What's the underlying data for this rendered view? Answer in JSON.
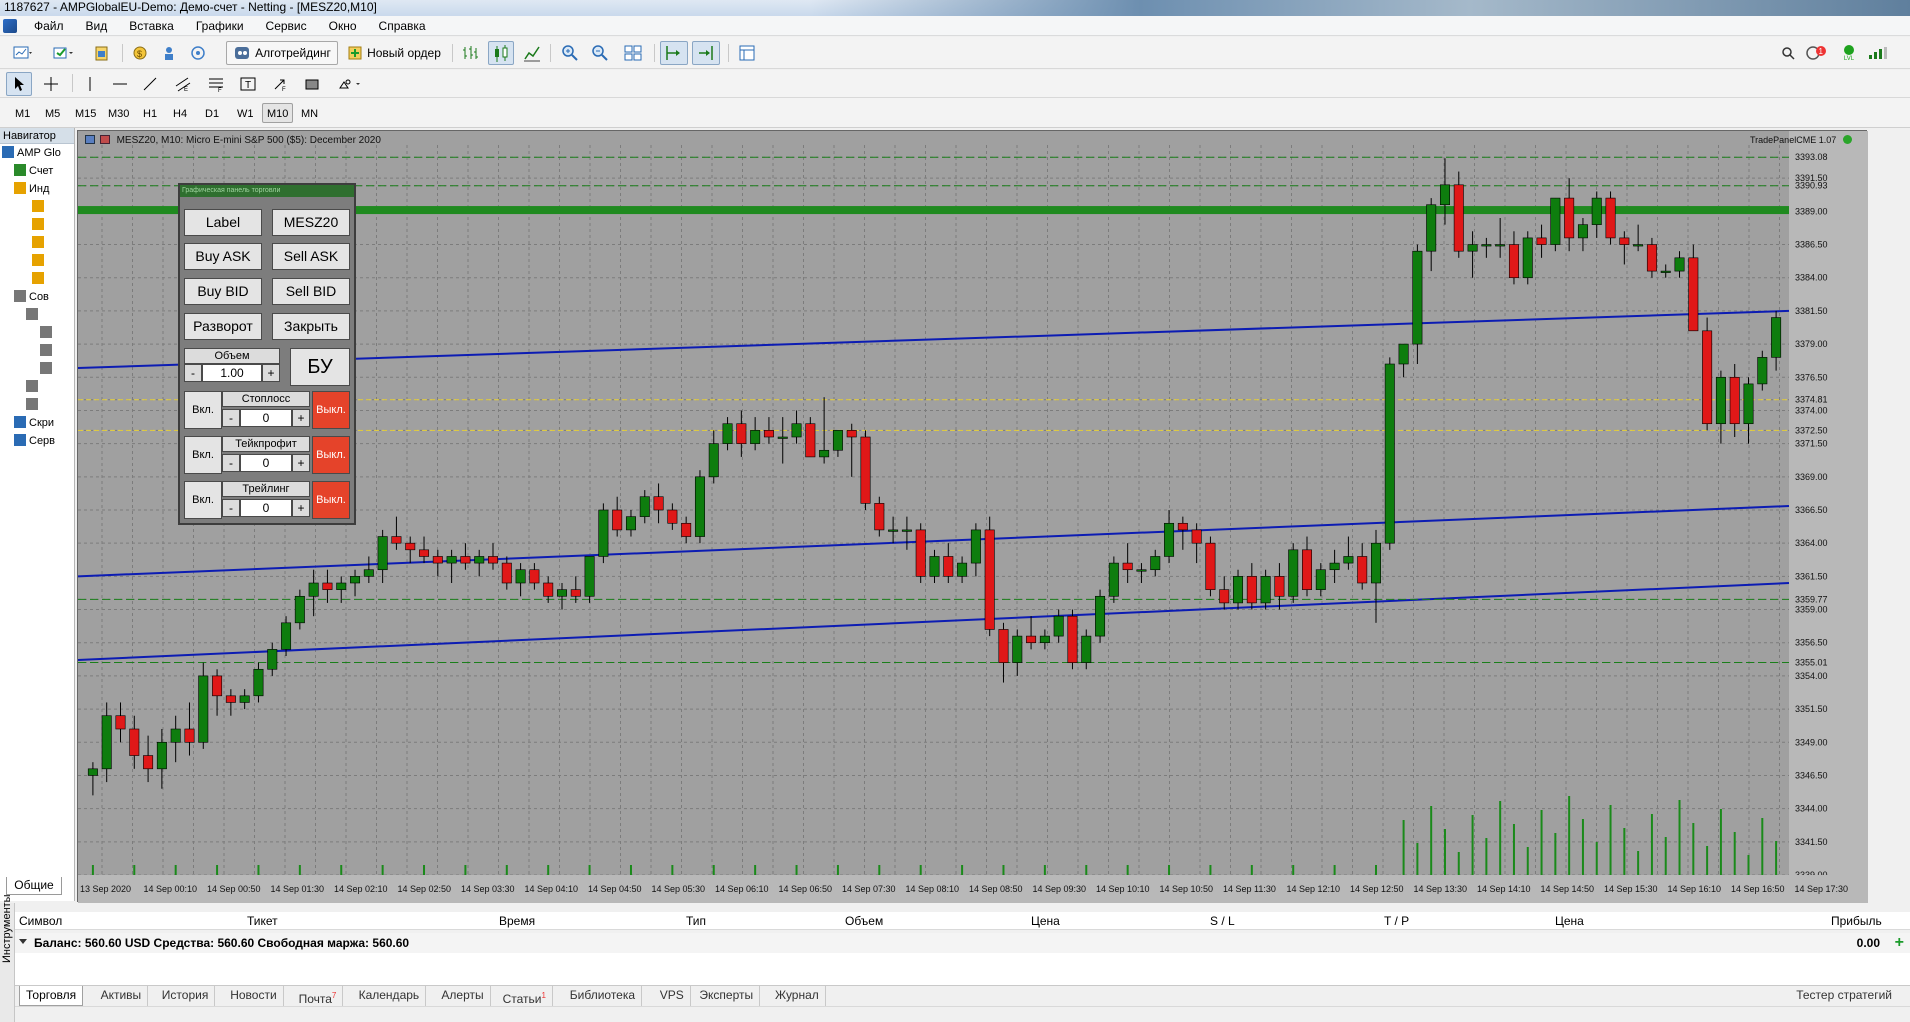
{
  "window": {
    "title": "1187627 - AMPGlobalEU-Demo: Демо-счет - Netting - [MESZ20,M10]"
  },
  "menu": [
    "Файл",
    "Вид",
    "Вставка",
    "Графики",
    "Сервис",
    "Окно",
    "Справка"
  ],
  "toolbar": {
    "algo_label": "Алготрейдинг",
    "new_order_label": "Новый ордер",
    "alert_badge": "1",
    "lvl_label": "LVL"
  },
  "timeframes": [
    "M1",
    "M5",
    "M15",
    "M30",
    "H1",
    "H4",
    "D1",
    "W1",
    "M10",
    "MN"
  ],
  "active_timeframe": "M10",
  "navigator": {
    "header": "Навигатор",
    "tab": "Общие",
    "rows": [
      "AMP Glo",
      "Счет",
      "Инд",
      "",
      "",
      "",
      "",
      "",
      "Сов",
      "",
      "",
      "",
      "",
      "",
      "",
      "Скри",
      "Серв"
    ]
  },
  "chart": {
    "title": "MESZ20, M10:  Micro E-mini S&P 500 ($5): December 2020",
    "ea_label": "TradePanelCME 1.07",
    "price_labels": [
      "3393.08",
      "3391.50",
      "3390.93",
      "3389.00",
      "3386.50",
      "3384.00",
      "3381.50",
      "3379.00",
      "3376.50",
      "3374.81",
      "3374.00",
      "3372.50",
      "3371.50",
      "3369.00",
      "3366.50",
      "3364.00",
      "3361.50",
      "3359.77",
      "3359.00",
      "3356.50",
      "3355.01",
      "3354.00",
      "3351.50",
      "3349.00",
      "3346.50",
      "3344.00",
      "3341.50",
      "3339.00"
    ],
    "time_labels": [
      "13 Sep 2020",
      "14 Sep 00:10",
      "14 Sep 00:50",
      "14 Sep 01:30",
      "14 Sep 02:10",
      "14 Sep 02:50",
      "14 Sep 03:30",
      "14 Sep 04:10",
      "14 Sep 04:50",
      "14 Sep 05:30",
      "14 Sep 06:10",
      "14 Sep 06:50",
      "14 Sep 07:30",
      "14 Sep 08:10",
      "14 Sep 08:50",
      "14 Sep 09:30",
      "14 Sep 10:10",
      "14 Sep 10:50",
      "14 Sep 11:30",
      "14 Sep 12:10",
      "14 Sep 12:50",
      "14 Sep 13:30",
      "14 Sep 14:10",
      "14 Sep 14:50",
      "14 Sep 15:30",
      "14 Sep 16:10",
      "14 Sep 16:50",
      "14 Sep 17:30"
    ],
    "colors": {
      "bull": "#0e7d0e",
      "bear": "#e01818",
      "channel": "#0c1cb3",
      "bg": "#a0a0a0",
      "grid": "#7c7c7c",
      "green_level": "#1f8a1f"
    }
  },
  "chart_data": {
    "type": "candlestick",
    "ylim": [
      3339,
      3394
    ],
    "candles": [
      [
        3346.5,
        3347.5,
        3345.0,
        3347.0
      ],
      [
        3347.0,
        3352.0,
        3346.0,
        3351.0
      ],
      [
        3351.0,
        3352.0,
        3349.0,
        3350.0
      ],
      [
        3350.0,
        3351.0,
        3347.0,
        3348.0
      ],
      [
        3348.0,
        3349.5,
        3346.0,
        3347.0
      ],
      [
        3347.0,
        3350.0,
        3345.5,
        3349.0
      ],
      [
        3349.0,
        3351.0,
        3347.5,
        3350.0
      ],
      [
        3350.0,
        3352.0,
        3348.0,
        3349.0
      ],
      [
        3349.0,
        3355.0,
        3348.5,
        3354.0
      ],
      [
        3354.0,
        3354.5,
        3351.0,
        3352.5
      ],
      [
        3352.5,
        3353.0,
        3351.0,
        3352.0
      ],
      [
        3352.0,
        3353.0,
        3351.5,
        3352.5
      ],
      [
        3352.5,
        3355.0,
        3352.0,
        3354.5
      ],
      [
        3354.5,
        3356.5,
        3354.0,
        3356.0
      ],
      [
        3356.0,
        3358.5,
        3355.5,
        3358.0
      ],
      [
        3358.0,
        3360.5,
        3357.5,
        3360.0
      ],
      [
        3360.0,
        3362.0,
        3358.5,
        3361.0
      ],
      [
        3361.0,
        3362.0,
        3359.5,
        3360.5
      ],
      [
        3360.5,
        3361.5,
        3359.5,
        3361.0
      ],
      [
        3361.0,
        3362.0,
        3360.0,
        3361.5
      ],
      [
        3361.5,
        3363.0,
        3361.0,
        3362.0
      ],
      [
        3362.0,
        3365.0,
        3361.0,
        3364.5
      ],
      [
        3364.5,
        3366.0,
        3363.5,
        3364.0
      ],
      [
        3364.0,
        3364.5,
        3362.5,
        3363.5
      ],
      [
        3363.5,
        3364.5,
        3362.5,
        3363.0
      ],
      [
        3363.0,
        3363.5,
        3361.5,
        3362.5
      ],
      [
        3362.5,
        3363.5,
        3361.0,
        3363.0
      ],
      [
        3363.0,
        3364.0,
        3362.0,
        3362.5
      ],
      [
        3362.5,
        3363.5,
        3361.5,
        3363.0
      ],
      [
        3363.0,
        3364.0,
        3362.0,
        3362.5
      ],
      [
        3362.5,
        3363.0,
        3360.5,
        3361.0
      ],
      [
        3361.0,
        3362.5,
        3360.0,
        3362.0
      ],
      [
        3362.0,
        3362.5,
        3360.5,
        3361.0
      ],
      [
        3361.0,
        3361.5,
        3359.5,
        3360.0
      ],
      [
        3360.0,
        3361.0,
        3359.0,
        3360.5
      ],
      [
        3360.5,
        3361.5,
        3359.5,
        3360.0
      ],
      [
        3360.0,
        3363.0,
        3359.5,
        3363.0
      ],
      [
        3363.0,
        3367.0,
        3362.5,
        3366.5
      ],
      [
        3366.5,
        3367.5,
        3364.5,
        3365.0
      ],
      [
        3365.0,
        3366.5,
        3364.5,
        3366.0
      ],
      [
        3366.0,
        3368.0,
        3365.5,
        3367.5
      ],
      [
        3367.5,
        3368.5,
        3365.5,
        3366.5
      ],
      [
        3366.5,
        3367.0,
        3365.0,
        3365.5
      ],
      [
        3365.5,
        3366.0,
        3364.0,
        3364.5
      ],
      [
        3364.5,
        3369.5,
        3364.0,
        3369.0
      ],
      [
        3369.0,
        3372.5,
        3368.5,
        3371.5
      ],
      [
        3371.5,
        3373.5,
        3371.0,
        3373.0
      ],
      [
        3373.0,
        3374.0,
        3370.5,
        3371.5
      ],
      [
        3371.5,
        3373.5,
        3371.0,
        3372.5
      ],
      [
        3372.5,
        3373.5,
        3371.5,
        3372.0
      ],
      [
        3372.0,
        3373.5,
        3370.0,
        3372.0
      ],
      [
        3372.0,
        3374.0,
        3371.5,
        3373.0
      ],
      [
        3373.0,
        3373.5,
        3370.5,
        3370.5
      ],
      [
        3370.5,
        3375.0,
        3370.0,
        3371.0
      ],
      [
        3371.0,
        3372.5,
        3370.5,
        3372.5
      ],
      [
        3372.5,
        3373.0,
        3369.0,
        3372.0
      ],
      [
        3372.0,
        3372.5,
        3366.5,
        3367.0
      ],
      [
        3367.0,
        3367.5,
        3364.5,
        3365.0
      ],
      [
        3365.0,
        3366.0,
        3364.0,
        3365.0
      ],
      [
        3365.0,
        3366.0,
        3363.5,
        3365.0
      ],
      [
        3365.0,
        3365.5,
        3361.0,
        3361.5
      ],
      [
        3361.5,
        3363.5,
        3361.0,
        3363.0
      ],
      [
        3363.0,
        3364.0,
        3361.0,
        3361.5
      ],
      [
        3361.5,
        3363.0,
        3361.0,
        3362.5
      ],
      [
        3362.5,
        3365.5,
        3361.5,
        3365.0
      ],
      [
        3365.0,
        3366.0,
        3357.0,
        3357.5
      ],
      [
        3357.5,
        3358.0,
        3353.5,
        3355.0
      ],
      [
        3355.0,
        3357.5,
        3354.0,
        3357.0
      ],
      [
        3357.0,
        3358.5,
        3356.0,
        3356.5
      ],
      [
        3356.5,
        3357.5,
        3356.0,
        3357.0
      ],
      [
        3357.0,
        3359.0,
        3356.5,
        3358.5
      ],
      [
        3358.5,
        3359.0,
        3354.5,
        3355.0
      ],
      [
        3355.0,
        3357.5,
        3354.5,
        3357.0
      ],
      [
        3357.0,
        3360.5,
        3356.5,
        3360.0
      ],
      [
        3360.0,
        3363.0,
        3359.5,
        3362.5
      ],
      [
        3362.5,
        3364.0,
        3361.0,
        3362.0
      ],
      [
        3362.0,
        3362.5,
        3361.0,
        3362.0
      ],
      [
        3362.0,
        3363.5,
        3361.5,
        3363.0
      ],
      [
        3363.0,
        3366.5,
        3362.5,
        3365.5
      ],
      [
        3365.5,
        3366.0,
        3363.5,
        3365.0
      ],
      [
        3365.0,
        3365.5,
        3362.5,
        3364.0
      ],
      [
        3364.0,
        3364.5,
        3360.0,
        3360.5
      ],
      [
        3360.5,
        3361.5,
        3359.0,
        3359.5
      ],
      [
        3359.5,
        3362.0,
        3359.0,
        3361.5
      ],
      [
        3361.5,
        3362.5,
        3359.0,
        3359.5
      ],
      [
        3359.5,
        3362.0,
        3359.0,
        3361.5
      ],
      [
        3361.5,
        3362.5,
        3359.0,
        3360.0
      ],
      [
        3360.0,
        3364.0,
        3359.5,
        3363.5
      ],
      [
        3363.5,
        3364.5,
        3360.0,
        3360.5
      ],
      [
        3360.5,
        3362.5,
        3360.0,
        3362.0
      ],
      [
        3362.0,
        3363.5,
        3361.0,
        3362.5
      ],
      [
        3362.5,
        3364.5,
        3362.0,
        3363.0
      ],
      [
        3363.0,
        3364.0,
        3360.5,
        3361.0
      ],
      [
        3361.0,
        3365.0,
        3358.0,
        3364.0
      ],
      [
        3364.0,
        3378.0,
        3363.5,
        3377.5
      ],
      [
        3377.5,
        3379.0,
        3376.5,
        3379.0
      ],
      [
        3379.0,
        3386.5,
        3377.5,
        3386.0
      ],
      [
        3386.0,
        3390.0,
        3384.5,
        3389.5
      ],
      [
        3389.5,
        3393.0,
        3388.0,
        3391.0
      ],
      [
        3391.0,
        3392.0,
        3385.5,
        3386.0
      ],
      [
        3386.0,
        3387.5,
        3384.0,
        3386.5
      ],
      [
        3386.5,
        3387.0,
        3385.5,
        3386.5
      ],
      [
        3386.5,
        3388.5,
        3385.5,
        3386.5
      ],
      [
        3386.5,
        3387.5,
        3383.5,
        3384.0
      ],
      [
        3384.0,
        3387.5,
        3383.5,
        3387.0
      ],
      [
        3387.0,
        3388.0,
        3385.5,
        3386.5
      ],
      [
        3386.5,
        3390.0,
        3386.0,
        3390.0
      ],
      [
        3390.0,
        3391.5,
        3386.0,
        3387.0
      ],
      [
        3387.0,
        3388.5,
        3386.0,
        3388.0
      ],
      [
        3388.0,
        3390.5,
        3387.0,
        3390.0
      ],
      [
        3390.0,
        3390.5,
        3386.5,
        3387.0
      ],
      [
        3387.0,
        3387.5,
        3385.0,
        3386.5
      ],
      [
        3386.5,
        3388.0,
        3386.0,
        3386.5
      ],
      [
        3386.5,
        3387.0,
        3384.0,
        3384.5
      ],
      [
        3384.5,
        3385.0,
        3384.0,
        3384.5
      ],
      [
        3384.5,
        3386.0,
        3384.0,
        3385.5
      ],
      [
        3385.5,
        3386.5,
        3380.0,
        3380.0
      ],
      [
        3380.0,
        3381.0,
        3372.5,
        3373.0
      ],
      [
        3373.0,
        3377.0,
        3371.5,
        3376.5
      ],
      [
        3376.5,
        3377.5,
        3372.0,
        3373.0
      ],
      [
        3373.0,
        3376.5,
        3371.5,
        3376.0
      ],
      [
        3376.0,
        3378.5,
        3375.5,
        3378.0
      ],
      [
        3378.0,
        3381.5,
        3377.0,
        3381.0
      ]
    ]
  },
  "panel": {
    "header": "Графическая панель торговли",
    "label_btn": "Label",
    "symbol_btn": "MESZ20",
    "buy_ask": "Buy ASK",
    "sell_ask": "Sell ASK",
    "buy_bid": "Buy BID",
    "sell_bid": "Sell BID",
    "reverse": "Разворот",
    "close": "Закрыть",
    "volume_label": "Объем",
    "volume_value": "1.00",
    "be": "БУ",
    "on": "Вкл.",
    "off": "Выкл.",
    "stoploss_label": "Стоплосс",
    "stoploss_value": "0",
    "takeprofit_label": "Тейкпрофит",
    "takeprofit_value": "0",
    "trailing_label": "Трейлинг",
    "trailing_value": "0",
    "minus": "-",
    "plus": "+"
  },
  "terminal": {
    "side_label": "Инструменты",
    "columns": [
      "Символ",
      "Тикет",
      "Время",
      "Тип",
      "Объем",
      "Цена",
      "S / L",
      "T / P",
      "Цена",
      "Прибыль"
    ],
    "balance": "Баланс: 560.60 USD  Средства: 560.60  Свободная маржа: 560.60",
    "profit": "0.00",
    "tabs": [
      {
        "label": "Торговля"
      },
      {
        "label": "Активы"
      },
      {
        "label": "История"
      },
      {
        "label": "Новости"
      },
      {
        "label": "Почта",
        "badge": "7"
      },
      {
        "label": "Календарь"
      },
      {
        "label": "Алерты"
      },
      {
        "label": "Статьи",
        "badge": "1"
      },
      {
        "label": "Библиотека"
      },
      {
        "label": "VPS"
      },
      {
        "label": "Эксперты"
      },
      {
        "label": "Журнал"
      }
    ],
    "tester": "Тестер стратегий"
  }
}
